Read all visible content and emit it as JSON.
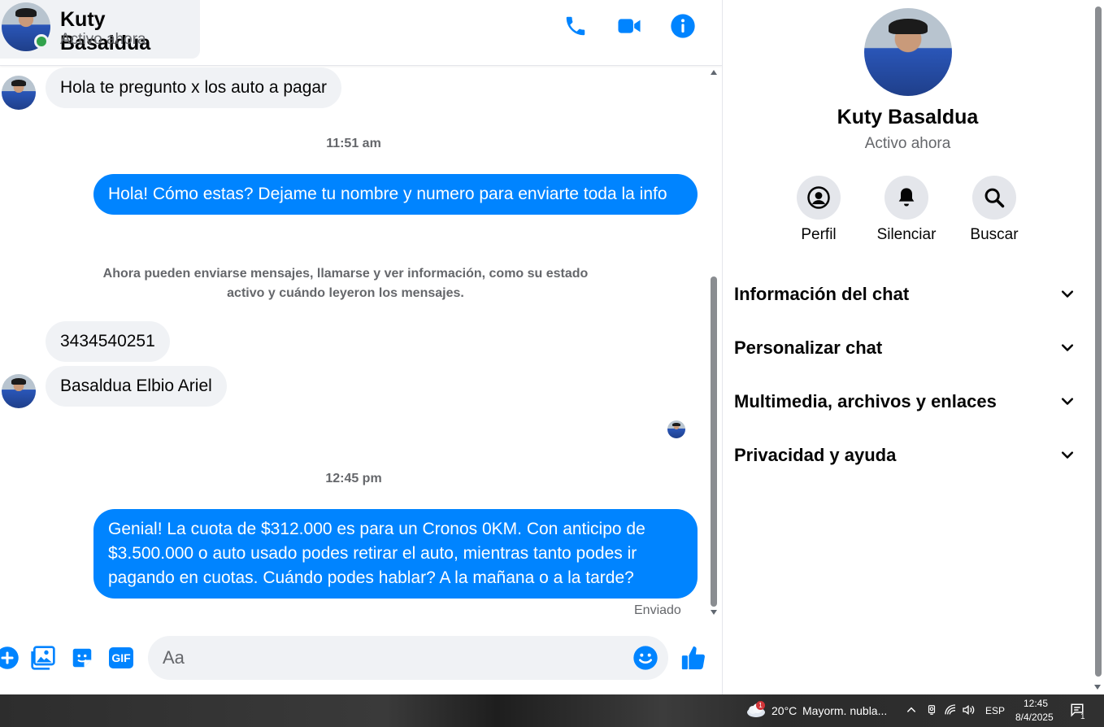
{
  "contact": {
    "name": "Kuty Basaldua",
    "status": "Activo ahora"
  },
  "messages": {
    "m1": "Hola te pregunto x los auto a pagar",
    "time1": "11:51 am",
    "m2": "Hola! Cómo estas? Dejame tu nombre y numero para enviarte toda la info",
    "notice_line1": "Ahora pueden enviarse mensajes, llamarse y ver información, como su estado",
    "notice_line2": "activo y cuándo leyeron los mensajes.",
    "m3": "3434540251",
    "m4": "Basaldua Elbio Ariel",
    "time2": "12:45 pm",
    "m5": "Genial! La cuota de $312.000 es para un Cronos 0KM. Con anticipo de $3.500.000 o auto usado podes retirar el auto, mientras tanto podes ir pagando en cuotas. Cuándo podes hablar? A la mañana o a la tarde?",
    "sent_status": "Enviado"
  },
  "composer": {
    "placeholder": "Aa",
    "gif_label": "GIF"
  },
  "info_panel": {
    "name": "Kuty Basaldua",
    "status": "Activo ahora",
    "actions": {
      "profile": "Perfil",
      "mute": "Silenciar",
      "search": "Buscar"
    },
    "sections": {
      "chat_info": "Información del chat",
      "customize": "Personalizar chat",
      "media": "Multimedia, archivos y enlaces",
      "privacy": "Privacidad y ayuda"
    }
  },
  "taskbar": {
    "weather_badge": "1",
    "temperature": "20°C",
    "weather_text": "Mayorm. nubla...",
    "language": "ESP",
    "time": "12:45",
    "date": "8/4/2025",
    "notification_count": "1"
  },
  "colors": {
    "messenger_blue": "#0084ff",
    "incoming_bubble": "#f0f2f5",
    "online_green": "#31a24c",
    "secondary_text": "#65676b"
  }
}
